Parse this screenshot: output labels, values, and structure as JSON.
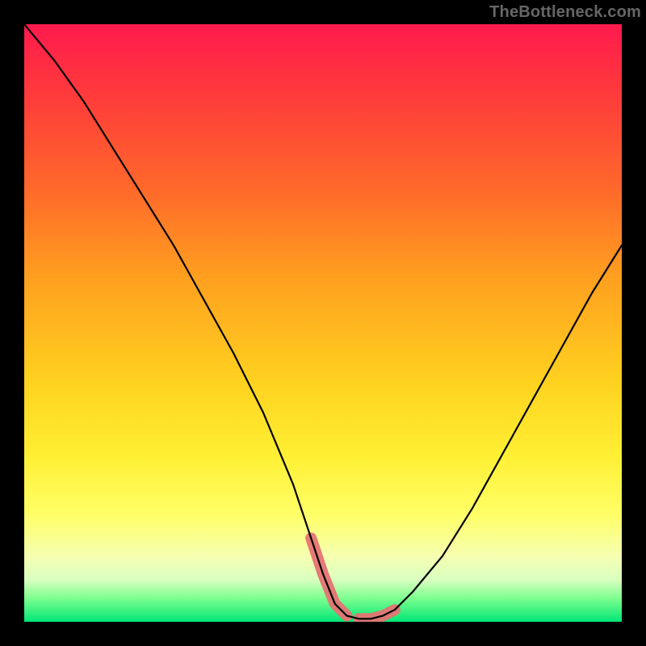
{
  "watermark": "TheBottleneck.com",
  "colors": {
    "background": "#000000",
    "gradient_top": "#ff1a4d",
    "gradient_bottom": "#00e676",
    "curve": "#000000",
    "highlight": "#e57373"
  },
  "chart_data": {
    "type": "line",
    "title": "",
    "xlabel": "",
    "ylabel": "",
    "xlim": [
      0,
      100
    ],
    "ylim": [
      0,
      100
    ],
    "series": [
      {
        "name": "bottleneck-curve",
        "x": [
          0,
          5,
          10,
          15,
          20,
          25,
          30,
          35,
          40,
          45,
          48,
          50,
          52,
          54,
          56,
          58,
          60,
          62,
          65,
          70,
          75,
          80,
          85,
          90,
          95,
          100
        ],
        "values": [
          100,
          94,
          87,
          79,
          71,
          63,
          54,
          45,
          35,
          23,
          14,
          8,
          3,
          1,
          0.5,
          0.5,
          1,
          2,
          5,
          11,
          19,
          28,
          37,
          46,
          55,
          63
        ]
      },
      {
        "name": "optimal-range-highlight",
        "x": [
          48,
          50,
          52,
          54,
          56,
          58,
          60,
          62
        ],
        "values": [
          14,
          8,
          3,
          1,
          0.5,
          0.5,
          1,
          2
        ]
      }
    ],
    "annotations": [],
    "legend": []
  }
}
